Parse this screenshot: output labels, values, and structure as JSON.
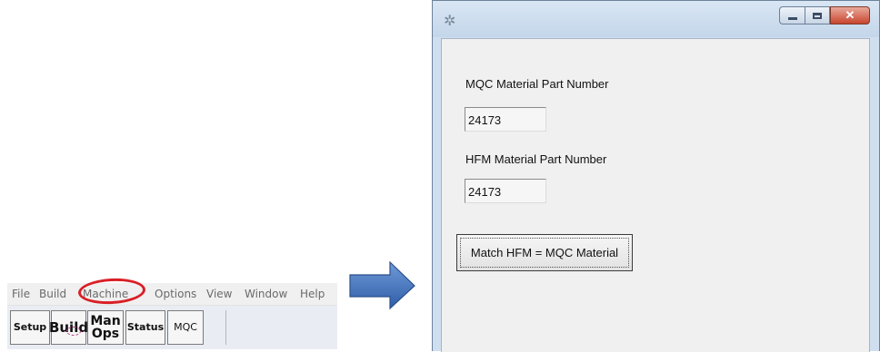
{
  "menu": [
    "File",
    "Build",
    "Machine",
    "Options",
    "View",
    "Window",
    "Help"
  ],
  "toolbar": {
    "setup": "Setup",
    "build": "Build",
    "man_ops_line1": "Man",
    "man_ops_line2": "Ops",
    "status": "Status",
    "mqc": "MQC"
  },
  "highlight_color": "#d91f26",
  "arrow_color": "#4a78c0",
  "dialog": {
    "title": "",
    "icon": "app-icon",
    "mqc_label": "MQC Material Part Number",
    "mqc_value": "24173",
    "hfm_label": "HFM Material Part Number",
    "hfm_value": "24173",
    "match_button": "Match HFM = MQC Material"
  }
}
